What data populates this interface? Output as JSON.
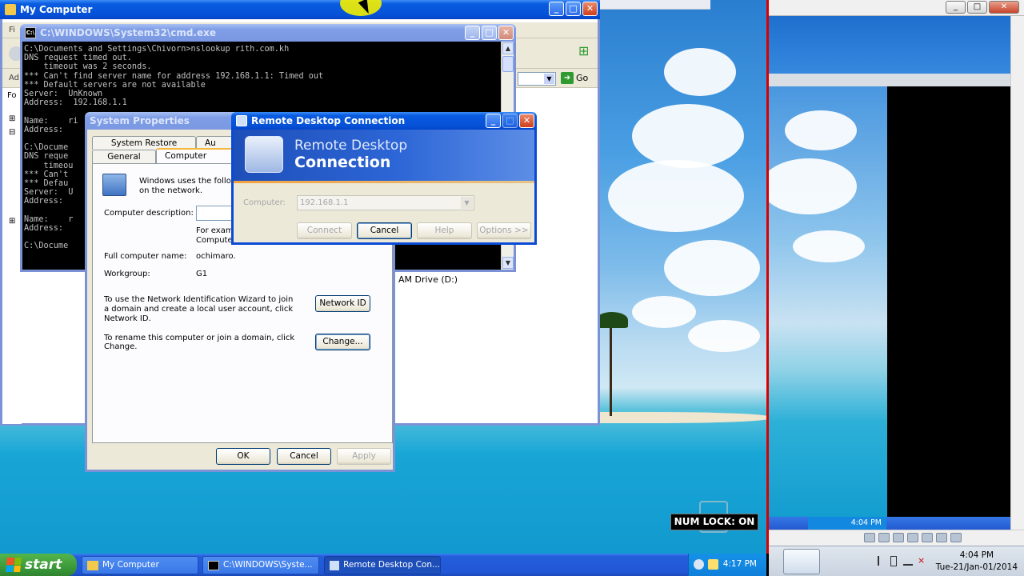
{
  "my_computer": {
    "title": "My Computer",
    "menu_fragment": "Fi",
    "address_fragment": "Ad",
    "left_fragment": "Fo",
    "go_label": "Go",
    "drive_label": "AM Drive (D:)"
  },
  "cmd": {
    "title": "C:\\WINDOWS\\System32\\cmd.exe",
    "lines": "C:\\Documents and Settings\\Chivorn>nslookup rith.com.kh\nDNS request timed out.\n    timeout was 2 seconds.\n*** Can't find server name for address 192.168.1.1: Timed out\n*** Default servers are not available\nServer:  UnKnown\nAddress:  192.168.1.1\n\nName:    ri\nAddress:\n\nC:\\Docume\nDNS reque\n    timeou\n*** Can't\n*** Defau\nServer:  U\nAddress:  \n\nName:    r\nAddress:  \n\nC:\\Docume"
  },
  "system_properties": {
    "title": "System Properties",
    "tabs_row1": [
      "System Restore",
      "Au"
    ],
    "tabs_row2": [
      "General",
      "Computer Name"
    ],
    "info_line1": "Windows uses the followi",
    "info_line2": "on the network.",
    "computer_description_label": "Computer description:",
    "example_line1": "For examp",
    "example_line2": "Computer",
    "full_name_label": "Full computer name:",
    "full_name_value": "ochimaro.",
    "workgroup_label": "Workgroup:",
    "workgroup_value": "G1",
    "network_id_text": "To use the Network Identification Wizard to join a domain and create a local user account, click Network ID.",
    "network_id_button": "Network ID",
    "change_text": "To rename this computer or join a domain, click Change.",
    "change_button": "Change...",
    "ok_button": "OK",
    "cancel_button": "Cancel",
    "apply_button": "Apply"
  },
  "rdc": {
    "title": "Remote Desktop Connection",
    "banner_line1": "Remote Desktop",
    "banner_line2": "Connection",
    "computer_label": "Computer:",
    "computer_value": "192.168.1.1",
    "connect_button": "Connect",
    "cancel_button": "Cancel",
    "help_button": "Help",
    "options_button": "Options >>"
  },
  "taskbar": {
    "start_label": "start",
    "tasks": [
      "My Computer",
      "C:\\WINDOWS\\Syste...",
      "Remote Desktop Con..."
    ],
    "clock": "4:17 PM"
  },
  "numlock": "NUM LOCK: ON",
  "right_pane": {
    "inner_clock": "4:04 PM",
    "clock_time": "4:04 PM",
    "clock_date": "Tue-21/Jan-01/2014"
  },
  "colors": {
    "xp_title_blue": "#0550d6",
    "xp_face": "#ece9d8",
    "start_green": "#3c9a3a",
    "vm_border_red": "#d90000"
  }
}
